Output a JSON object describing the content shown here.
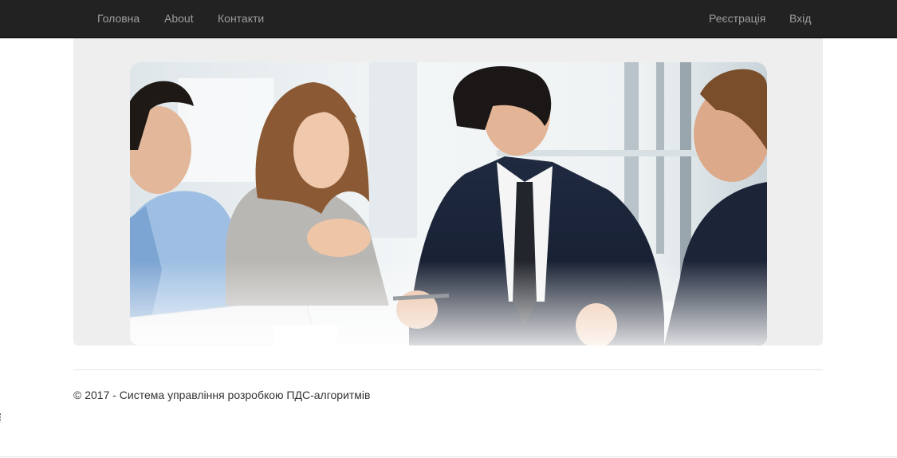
{
  "nav": {
    "left": [
      {
        "label": "Головна"
      },
      {
        "label": "About"
      },
      {
        "label": "Контакти"
      }
    ],
    "right": [
      {
        "label": "Реєстрація"
      },
      {
        "label": "Вхід"
      }
    ]
  },
  "hero": {
    "image": "business-meeting-photo"
  },
  "footer": {
    "text": "© 2017 - Система управління розробкою ПДС-алгоритмів"
  },
  "colors": {
    "navbar_bg": "#222222",
    "nav_link": "#9d9d9d",
    "jumbotron_bg": "#eeeeee",
    "footer_text": "#333333"
  }
}
